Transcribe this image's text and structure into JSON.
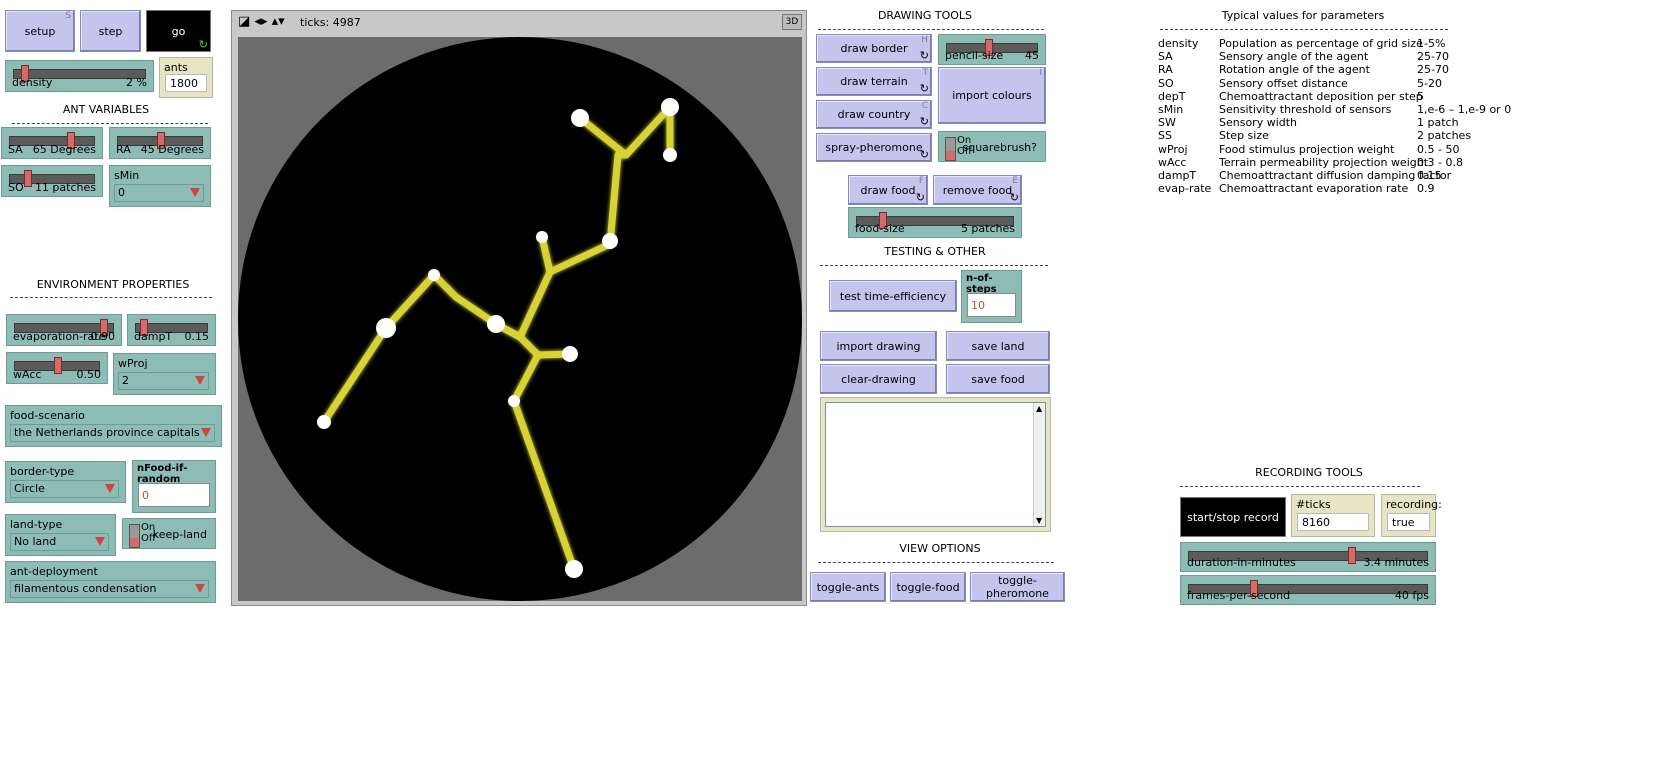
{
  "buttons": {
    "setup": {
      "label": "setup",
      "key": "S"
    },
    "step": {
      "label": "step"
    },
    "go": {
      "label": "go"
    },
    "draw_border": {
      "label": "draw border",
      "key": "H"
    },
    "draw_terrain": {
      "label": "draw terrain",
      "key": "T"
    },
    "draw_country": {
      "label": "draw country",
      "key": "C"
    },
    "spray_pheromone": {
      "label": "spray-pheromone"
    },
    "import_colours": {
      "label": "import colours",
      "key": "I"
    },
    "draw_food": {
      "label": "draw food",
      "key": "F"
    },
    "remove_food": {
      "label": "remove food",
      "key": "E"
    },
    "test_time_efficiency": {
      "label": "test time-efficiency"
    },
    "import_drawing": {
      "label": "import drawing"
    },
    "save_land": {
      "label": "save land"
    },
    "clear_drawing": {
      "label": "clear-drawing"
    },
    "save_food": {
      "label": "save food"
    },
    "toggle_ants": {
      "label": "toggle-ants"
    },
    "toggle_food": {
      "label": "toggle-food"
    },
    "toggle_pheromone": {
      "label": "toggle-pheromone"
    },
    "start_stop_record": {
      "label": "start/stop record"
    }
  },
  "sliders": {
    "density": {
      "name": "density",
      "value": "2 %",
      "fraction": 0.08
    },
    "sa": {
      "name": "SA",
      "value": "65 Degrees",
      "fraction": 0.72
    },
    "ra": {
      "name": "RA",
      "value": "45 Degrees",
      "fraction": 0.5
    },
    "so": {
      "name": "SO",
      "value": "11 patches",
      "fraction": 0.2
    },
    "evaporation_rate": {
      "name": "evaporation-rate",
      "value": "0.90",
      "fraction": 0.9
    },
    "dampt": {
      "name": "dampT",
      "value": "0.15",
      "fraction": 0.1
    },
    "wacc": {
      "name": "wAcc",
      "value": "0.50",
      "fraction": 0.5
    },
    "pencil_size": {
      "name": "pencil-size",
      "value": "45",
      "fraction": 0.45
    },
    "food_size": {
      "name": "food-size",
      "value": "5 patches",
      "fraction": 0.16
    },
    "duration_in_minutes": {
      "name": "duration-in-minutes",
      "value": "3.4 minutes",
      "fraction": 0.68
    },
    "frames_per_second": {
      "name": "frames-per-second",
      "value": "40 fps",
      "fraction": 0.27
    }
  },
  "monitors": {
    "ants": {
      "name": "ants",
      "value": "1800"
    },
    "recording": {
      "name": "recording:",
      "value": "true"
    }
  },
  "inputs": {
    "n_food_if_random": {
      "name": "nFood-if-random",
      "value": "0"
    },
    "n_of_steps": {
      "name": "n-of-steps",
      "value": "10"
    },
    "ticks_recording": {
      "name": "#ticks recording:",
      "value": "8160"
    }
  },
  "choosers": {
    "smin": {
      "name": "sMin",
      "value": "0"
    },
    "wproj": {
      "name": "wProj",
      "value": "2"
    },
    "food_scenario": {
      "name": "food-scenario",
      "value": "the Netherlands province capitals"
    },
    "border_type": {
      "name": "border-type",
      "value": "Circle"
    },
    "land_type": {
      "name": "land-type",
      "value": "No land"
    },
    "ant_deployment": {
      "name": "ant-deployment",
      "value": "filamentous condensation"
    }
  },
  "switches": {
    "squarebrush": {
      "name": "squarebrush?",
      "on": "On",
      "off": "Off"
    },
    "keep_land": {
      "name": "keep-land",
      "on": "On",
      "off": "Off"
    }
  },
  "notes": {
    "ant_variables": "ANT VARIABLES",
    "environment_properties": "ENVIRONMENT PROPERTIES",
    "drawing_tools": "DRAWING TOOLS",
    "testing_other": "TESTING & OTHER",
    "view_options": "VIEW OPTIONS",
    "recording_tools": "RECORDING TOOLS",
    "typical_values": "Typical values for parameters"
  },
  "view": {
    "ticks": "ticks: 4987",
    "three_d": "3D"
  },
  "parameters": [
    {
      "name": "density",
      "desc": "Population as percentage of grid size",
      "value": "1-5%"
    },
    {
      "name": "SA",
      "desc": "Sensory angle of the agent",
      "value": "25-70"
    },
    {
      "name": "RA",
      "desc": "Rotation angle of the agent",
      "value": "25-70"
    },
    {
      "name": "SO",
      "desc": "Sensory offset distance",
      "value": "5-20"
    },
    {
      "name": "depT",
      "desc": "Chemoattractant deposition per step",
      "value": "5"
    },
    {
      "name": "sMin",
      "desc": "Sensitivity threshold of sensors",
      "value": "1,e-6 – 1,e-9 or 0"
    },
    {
      "name": "SW",
      "desc": "Sensory width",
      "value": "1 patch"
    },
    {
      "name": "SS",
      "desc": "Step size",
      "value": "2 patches"
    },
    {
      "name": "wProj",
      "desc": "Food stimulus projection weight",
      "value": "0.5 - 50"
    },
    {
      "name": "wAcc",
      "desc": "Terrain permeability projection weight",
      "value": "0.3 - 0.8"
    },
    {
      "name": "dampT",
      "desc": "Chemoattractant diffusion damping factor",
      "value": "0.15"
    },
    {
      "name": "evap-rate",
      "desc": "Chemoattractant evaporation rate",
      "value": "0.9"
    }
  ],
  "colors": {
    "button": "#c4c4ec",
    "widget": "#8cbcb3",
    "monitor": "#e5e5c6",
    "trail": "#f0ea3a",
    "food": "#ffffff"
  }
}
